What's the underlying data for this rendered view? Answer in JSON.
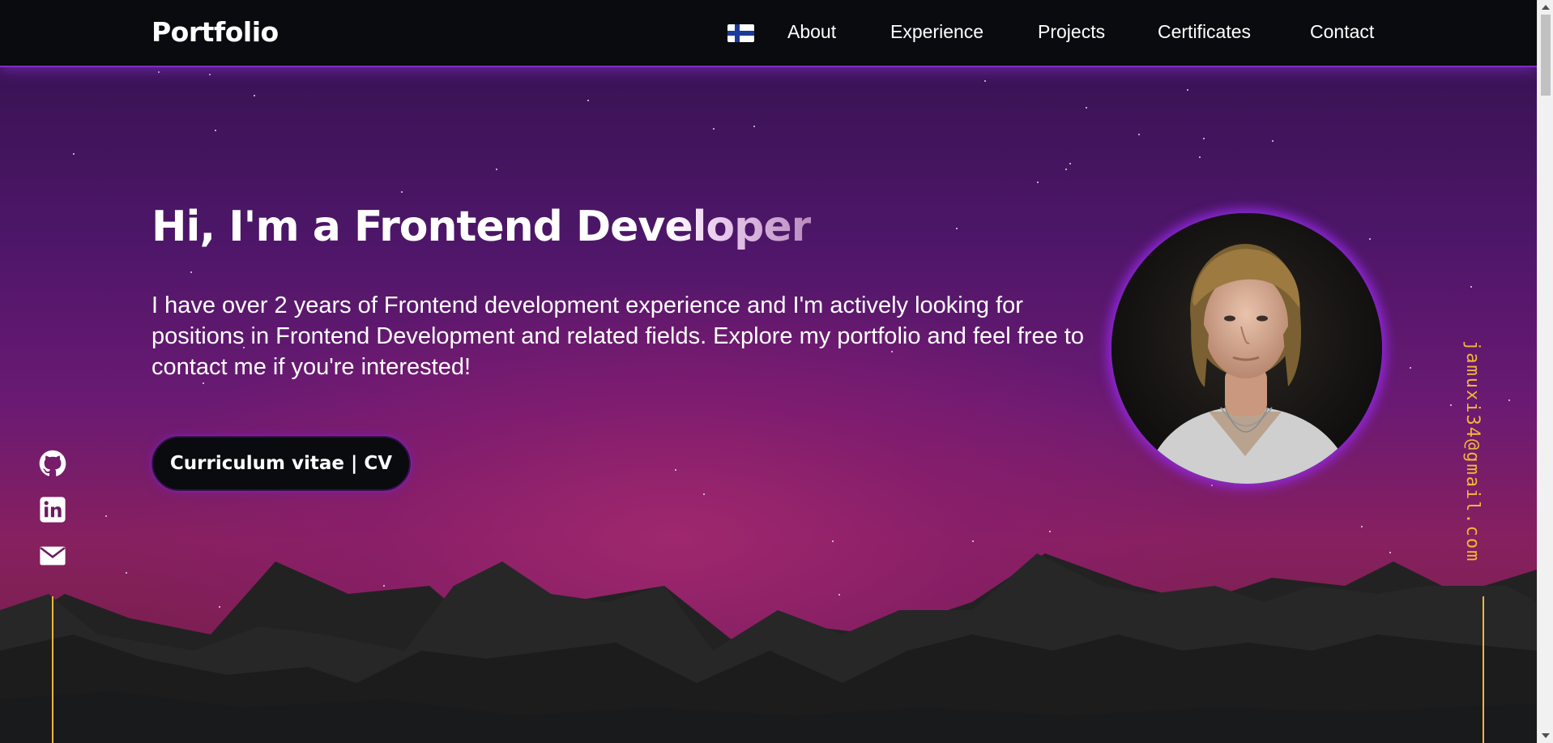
{
  "header": {
    "logo": "Portfolio",
    "language_flag": "finland-flag-icon",
    "nav": [
      {
        "label": "About"
      },
      {
        "label": "Experience"
      },
      {
        "label": "Projects"
      },
      {
        "label": "Certificates"
      },
      {
        "label": "Contact"
      }
    ]
  },
  "hero": {
    "title_solid": "Hi, I'm a Frontend Dev",
    "title_fade": "eloper",
    "description": "I have over 2 years of Frontend development experience and I'm actively looking for positions in Frontend Development and related fields. Explore my portfolio and feel free to contact me if you're interested!",
    "cv_button": "Curriculum vitae | CV"
  },
  "social": [
    {
      "icon": "github-icon"
    },
    {
      "icon": "linkedin-icon"
    },
    {
      "icon": "mail-icon"
    }
  ],
  "email": "jamuxi34@gmail.com",
  "colors": {
    "accent": "#f2b73a",
    "glow": "#7b2fc0",
    "background": "#0a0b0e"
  }
}
